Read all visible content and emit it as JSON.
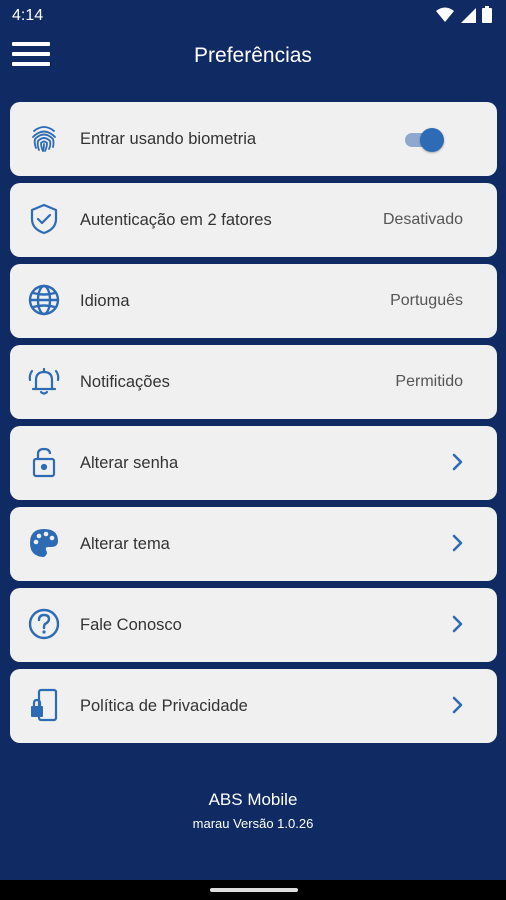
{
  "status_bar": {
    "time": "4:14",
    "icons": [
      "wifi-icon",
      "signal-icon",
      "battery-icon"
    ]
  },
  "app_bar": {
    "title": "Preferências",
    "menu_icon": "hamburger-menu-icon"
  },
  "colors": {
    "background": "#102a63",
    "card": "#f0f0f0",
    "accent": "#2d6bb5",
    "toggle_track": "#8fa8cf"
  },
  "settings": [
    {
      "label": "Entrar usando biometria",
      "icon": "fingerprint-icon",
      "control": "toggle",
      "enabled": true
    },
    {
      "label": "Autenticação em 2 fatores",
      "icon": "shield-check-icon",
      "value": "Desativado"
    },
    {
      "label": "Idioma",
      "icon": "globe-icon",
      "value": "Português"
    },
    {
      "label": "Notificações",
      "icon": "bell-icon",
      "value": "Permitido"
    },
    {
      "label": "Alterar senha",
      "icon": "lock-icon",
      "control": "chevron-right-icon"
    },
    {
      "label": "Alterar tema",
      "icon": "palette-icon",
      "control": "chevron-right-icon"
    },
    {
      "label": "Fale Conosco",
      "icon": "help-circle-icon",
      "control": "chevron-right-icon"
    },
    {
      "label": "Política de Privacidade",
      "icon": "phone-lock-icon",
      "control": "chevron-right-icon"
    }
  ],
  "footer": {
    "app_name": "ABS Mobile",
    "version": "marau Versão 1.0.26"
  }
}
